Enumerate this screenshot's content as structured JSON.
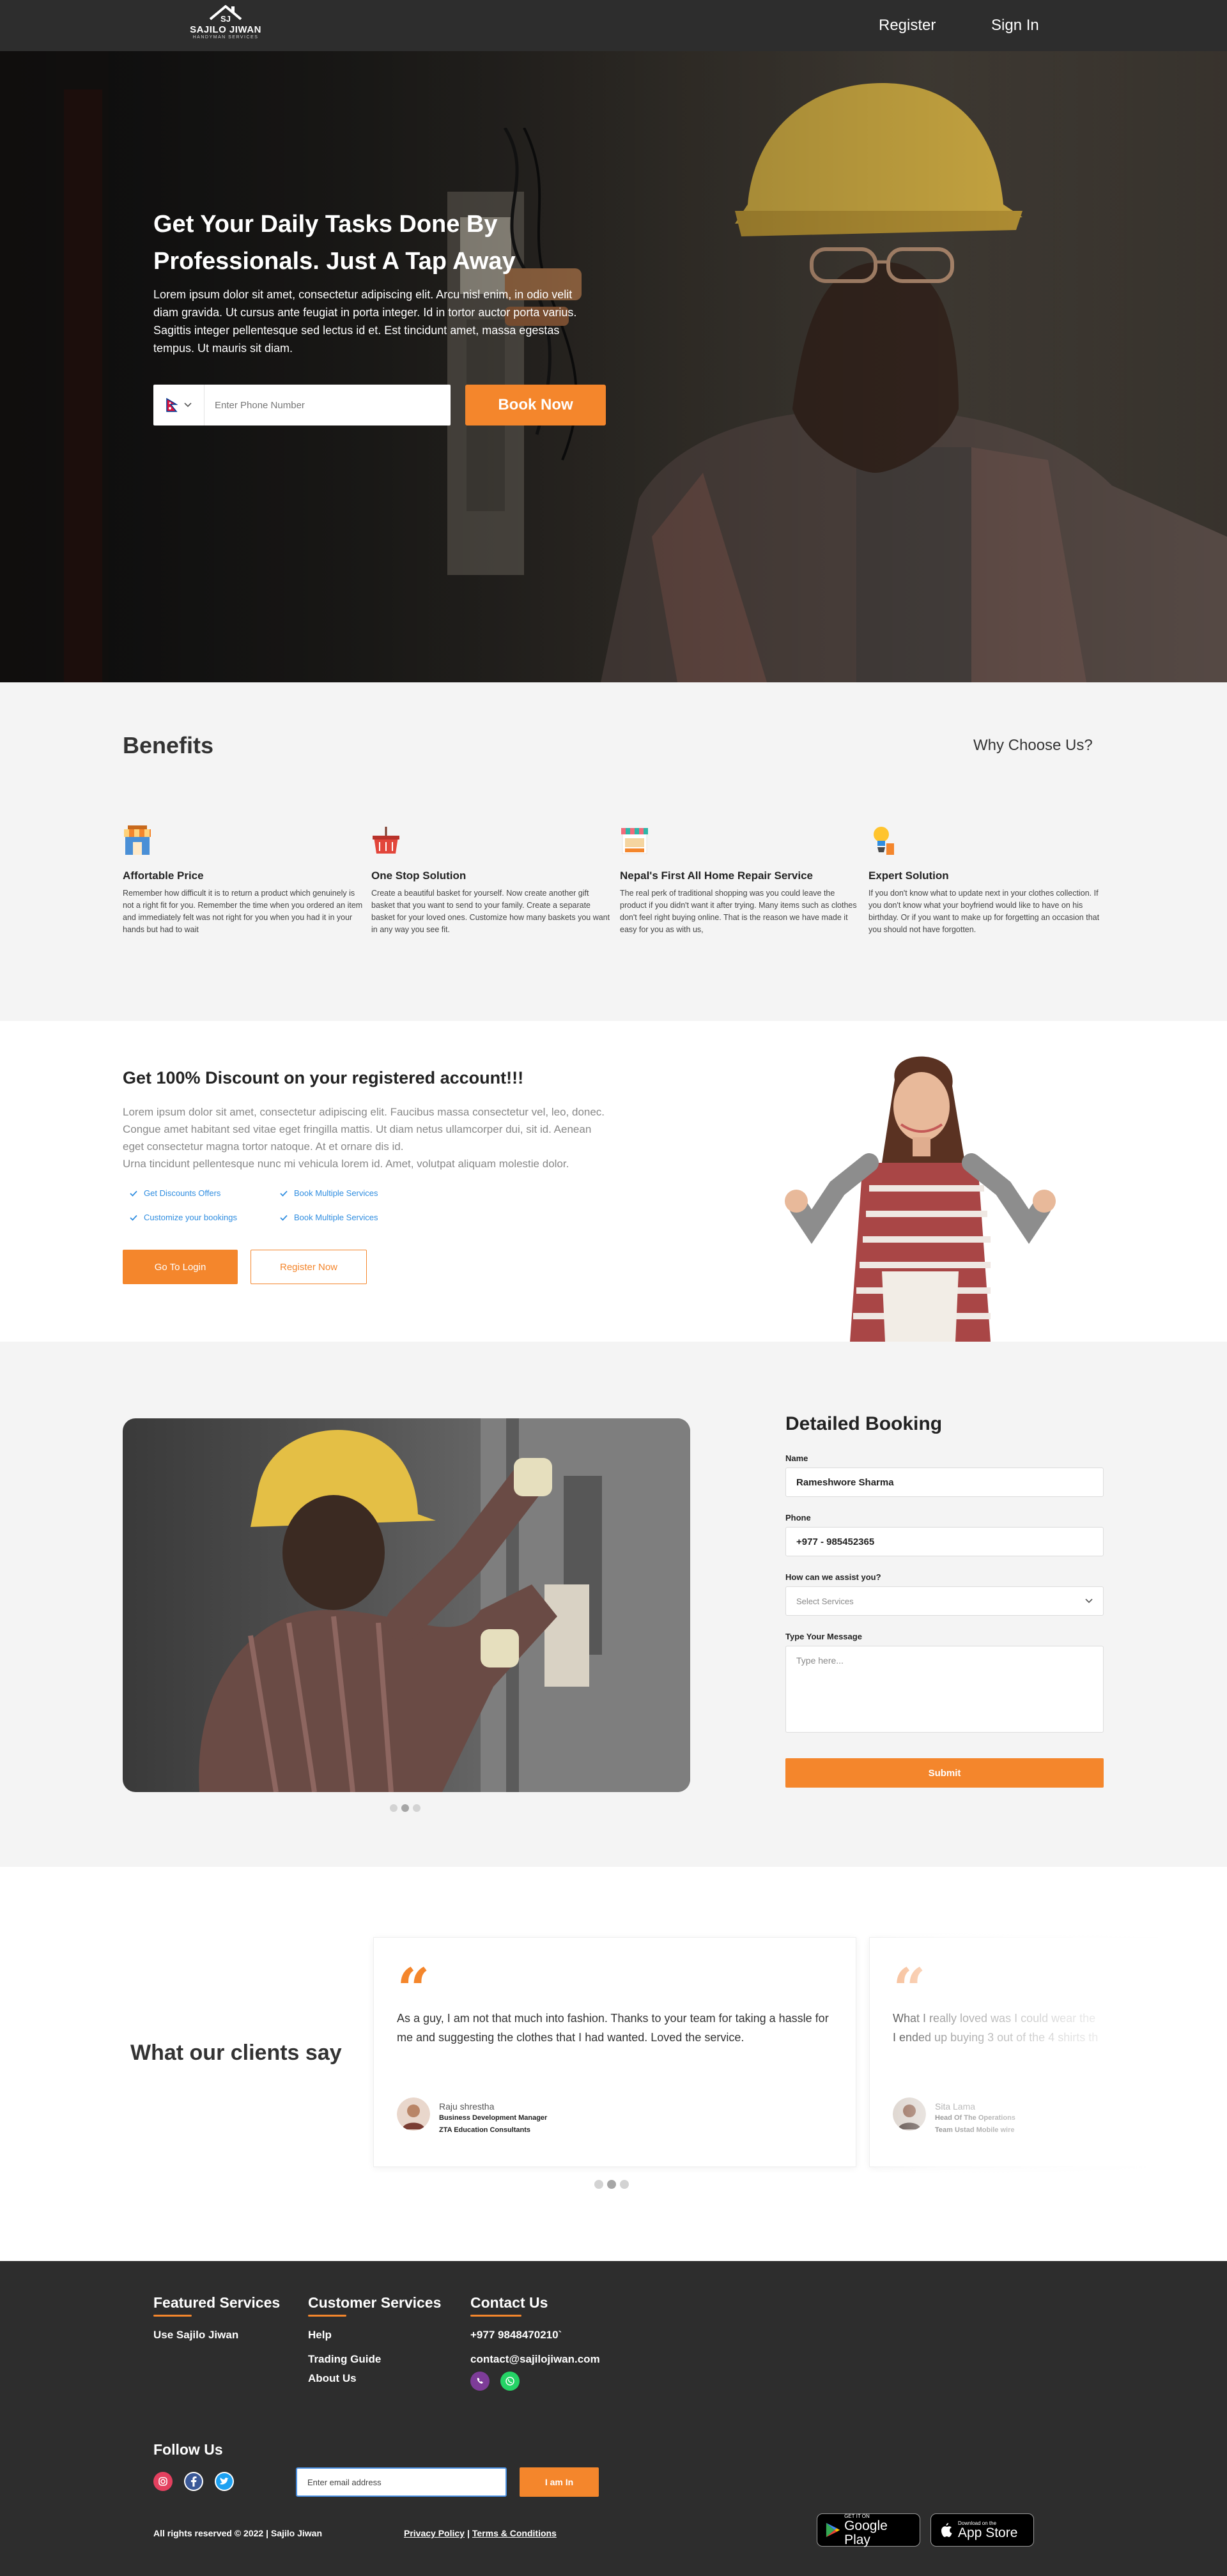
{
  "brand": {
    "name": "SAJILO JIWAN",
    "tagline": "HANDYMAN SERVICES",
    "logo_mark": "SJ"
  },
  "nav": {
    "register": "Register",
    "signin": "Sign In"
  },
  "hero": {
    "title_line1": "Get Your Daily Tasks Done By",
    "title_line2": "Professionals. Just A Tap Away",
    "text": "Lorem ipsum dolor sit amet, consectetur adipiscing elit. Arcu nisl enim, in odio velit diam gravida. Ut cursus ante feugiat in porta integer. Id in tortor auctor porta varius. Sagittis integer pellentesque sed lectus id et. Est tincidunt amet, massa egestas tempus. Ut mauris sit diam.",
    "phone_placeholder": "Enter Phone Number",
    "book_label": "Book Now"
  },
  "benefits": {
    "title": "Benefits",
    "why": "Why Choose Us?",
    "items": [
      {
        "title": "Affortable Price",
        "text": "Remember how difficult it is to return a product which genuinely is not a right fit for you. Remember the time when you ordered an item and immediately felt was not right for you when you had it in your hands but had to wait"
      },
      {
        "title": "One Stop Solution",
        "text": "Create a beautiful basket for yourself. Now create another gift basket that you want to send to your family. Create a separate basket for your loved ones. Customize how many baskets you want in any way you see fit."
      },
      {
        "title": "Nepal's First All Home Repair Service",
        "text": "The real perk of traditional shopping was you could leave the product if you didn't want it after trying. Many items such as clothes don't feel right buying online. That is the reason we have made it easy for you as with us,"
      },
      {
        "title": "Expert Solution",
        "text": "If you don't know what to update next in your clothes collection. If you don't know what your boyfriend would like to have on his birthday. Or if you want to make up for forgetting an occasion that you should not have forgotten."
      }
    ]
  },
  "discount": {
    "title": "Get 100% Discount on your registered account!!!",
    "text_line1": "Lorem ipsum dolor sit amet, consectetur adipiscing elit. Faucibus massa consectetur vel, leo, donec. Congue amet habitant sed vitae eget fringilla mattis. Ut diam netus ullamcorper dui, sit id. Aenean eget consectetur magna tortor natoque. At et ornare dis id.",
    "text_line2": "Urna tincidunt pellentesque nunc mi vehicula lorem id. Amet, volutpat aliquam molestie dolor.",
    "checks": [
      "Get Discounts Offers",
      "Book Multiple Services",
      "Customize your bookings",
      "Book Multiple Services"
    ],
    "login_label": "Go To Login",
    "register_label": "Register Now"
  },
  "booking": {
    "title": "Detailed Booking",
    "name_label": "Name",
    "name_value": "Rameshwore Sharma",
    "phone_label": "Phone",
    "phone_value": "+977 - 985452365",
    "assist_label": "How can we assist you?",
    "assist_value": "Select Services",
    "message_label": "Type Your Message",
    "message_placeholder": "Type here...",
    "submit_label": "Submit"
  },
  "testimonials": {
    "title": "What our clients say",
    "items": [
      {
        "text": "As a guy, I am not that much into fashion. Thanks to your team for taking a hassle for me and suggesting the clothes that I had wanted. Loved the service.",
        "name": "Raju shrestha",
        "role": "Business Development Manager",
        "company": "ZTA Education Consultants"
      },
      {
        "text_line1": "What I really loved was I could wear the",
        "text_line2": "I ended up buying 3 out of the 4 shirts th",
        "name": "Sita Lama",
        "role": "Head Of The Operations",
        "company": "Team Ustad Mobile wire"
      }
    ]
  },
  "footer": {
    "featured_title": "Featured Services",
    "featured_link": "Use Sajilo Jiwan",
    "customer_title": "Customer Services",
    "customer_links": [
      "Help",
      "Trading Guide",
      "About Us"
    ],
    "contact_title": "Contact Us",
    "phone": "+977 9848470210`",
    "email": "contact@sajilojiwan.com",
    "follow_title": "Follow Us",
    "email_placeholder": "Enter email address",
    "iamin_label": "I am In",
    "copyright": "All rights reserved © 2022 | Sajilo Jiwan",
    "privacy": "Privacy Policy",
    "separator": "|",
    "terms": "Terms & Conditions",
    "google_small": "GET IT ON",
    "google_big": "Google Play",
    "apple_small": "Download on the",
    "apple_big": "App Store"
  },
  "colors": {
    "accent": "#f4862c",
    "dark": "#2d2d2d",
    "light_bg": "#f4f4f4",
    "link_blue": "#2f8de0"
  }
}
